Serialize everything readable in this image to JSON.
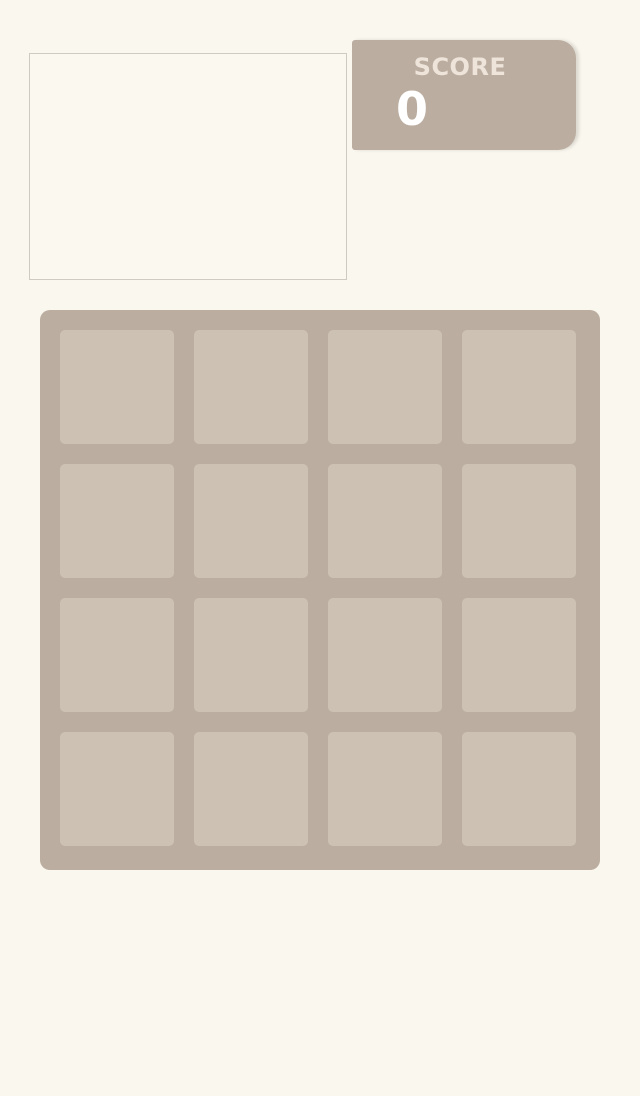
{
  "score": {
    "label": "SCORE",
    "value": "0"
  },
  "board": {
    "size": 4,
    "cells": [
      [
        "",
        "",
        "",
        ""
      ],
      [
        "",
        "",
        "",
        ""
      ],
      [
        "",
        "",
        "",
        ""
      ],
      [
        "",
        "",
        "",
        ""
      ]
    ]
  },
  "colors": {
    "background": "#faf7ee",
    "board": "#bbada0",
    "empty_cell": "#cdc1b4",
    "score_label": "#eee4da",
    "score_value": "#ffffff"
  }
}
